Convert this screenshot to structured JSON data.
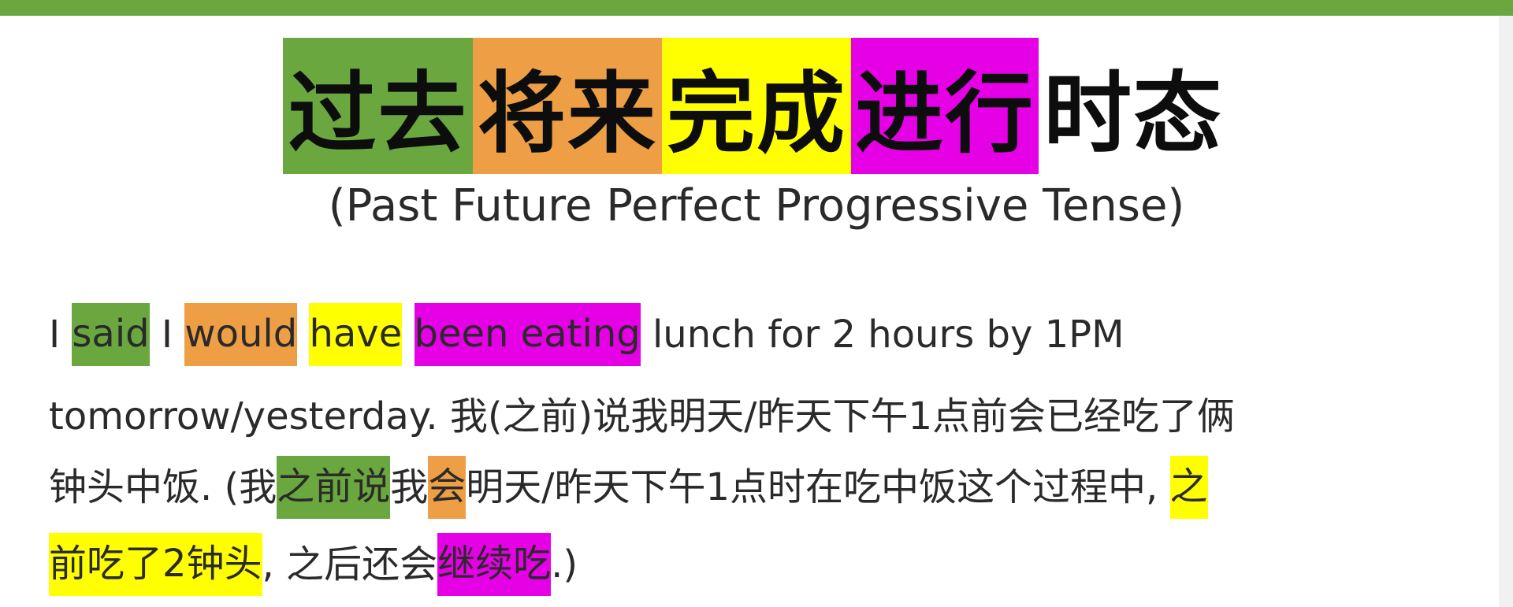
{
  "colors": {
    "top_bar": "#6aa83f",
    "green": "#6aa83f",
    "orange": "#ee9f45",
    "yellow": "#ffff00",
    "magenta": "#e600e6"
  },
  "title": {
    "blocks": [
      {
        "text": "过去",
        "color": "#6aa83f"
      },
      {
        "text": "将来",
        "color": "#ee9f45"
      },
      {
        "text": "完成",
        "color": "#ffff00"
      },
      {
        "text": "进行",
        "color": "#e600e6"
      },
      {
        "text": "时态",
        "color": "#ffffff"
      }
    ],
    "subtitle": "(Past Future Perfect Progressive Tense)"
  },
  "lines": [
    [
      {
        "text": "I ",
        "hl": ""
      },
      {
        "text": "said",
        "hl": "#6aa83f"
      },
      {
        "text": " I ",
        "hl": ""
      },
      {
        "text": "would",
        "hl": "#ee9f45"
      },
      {
        "text": " ",
        "hl": ""
      },
      {
        "text": "have",
        "hl": "#ffff00"
      },
      {
        "text": " ",
        "hl": ""
      },
      {
        "text": "been eating",
        "hl": "#e600e6"
      },
      {
        "text": " lunch for 2 hours by 1PM",
        "hl": ""
      }
    ],
    [
      {
        "text": "tomorrow/yesterday. 我(之前)说我明天/昨天下午1点前会已经吃了俩",
        "hl": ""
      }
    ],
    [
      {
        "text": "钟头中饭. (我",
        "hl": ""
      },
      {
        "text": "之前说",
        "hl": "#6aa83f"
      },
      {
        "text": "我",
        "hl": ""
      },
      {
        "text": "会",
        "hl": "#ee9f45"
      },
      {
        "text": "明天/昨天下午1点时在吃中饭这个过程中, ",
        "hl": ""
      },
      {
        "text": "之",
        "hl": "#ffff00"
      }
    ],
    [
      {
        "text": "前吃了2钟头",
        "hl": "#ffff00"
      },
      {
        "text": ", 之后还会",
        "hl": ""
      },
      {
        "text": "继续吃",
        "hl": "#e600e6"
      },
      {
        "text": ".)",
        "hl": ""
      }
    ]
  ]
}
